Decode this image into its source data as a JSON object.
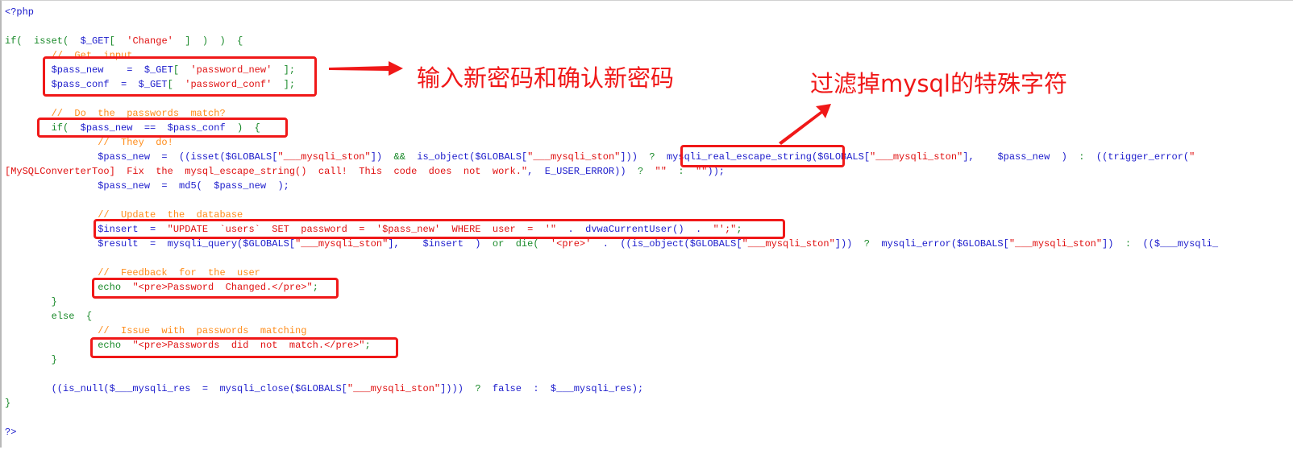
{
  "colors": {
    "variable": "#1c1ccc",
    "keyword": "#1a8a2a",
    "string": "#e01010",
    "comment": "#ff8c1a",
    "annotation": "#f01818"
  },
  "annotations": {
    "input_note": "输入新密码和确认新密码",
    "filter_note": "过滤掉mysql的特殊字符"
  },
  "code": {
    "lines": [
      [
        {
          "c": "b",
          "t": "<?php"
        }
      ],
      [],
      [
        {
          "c": "g",
          "t": "if(  isset(  "
        },
        {
          "c": "b",
          "t": "$_GET"
        },
        {
          "c": "g",
          "t": "[  "
        },
        {
          "c": "r",
          "t": "'Change'"
        },
        {
          "c": "g",
          "t": "  ]  )  )  {"
        }
      ],
      [
        {
          "c": "o",
          "t": "        //  Get  input"
        }
      ],
      [
        {
          "c": "b",
          "t": "        $pass_new    =  $_GET"
        },
        {
          "c": "g",
          "t": "[  "
        },
        {
          "c": "r",
          "t": "'password_new'"
        },
        {
          "c": "g",
          "t": "  ];"
        }
      ],
      [
        {
          "c": "b",
          "t": "        $pass_conf  =  $_GET"
        },
        {
          "c": "g",
          "t": "[  "
        },
        {
          "c": "r",
          "t": "'password_conf'"
        },
        {
          "c": "g",
          "t": "  ];"
        }
      ],
      [],
      [
        {
          "c": "o",
          "t": "        //  Do  the  passwords  match?"
        }
      ],
      [
        {
          "c": "g",
          "t": "        if(  "
        },
        {
          "c": "b",
          "t": "$pass_new  ==  $pass_conf"
        },
        {
          "c": "g",
          "t": "  )  {"
        }
      ],
      [
        {
          "c": "o",
          "t": "                //  They  do!"
        }
      ],
      [
        {
          "c": "b",
          "t": "                $pass_new  =  ((isset($GLOBALS["
        },
        {
          "c": "r",
          "t": "\"___mysqli_ston\""
        },
        {
          "c": "b",
          "t": "])  "
        },
        {
          "c": "g",
          "t": "&&"
        },
        {
          "c": "b",
          "t": "  is_object($GLOBALS["
        },
        {
          "c": "r",
          "t": "\"___mysqli_ston\""
        },
        {
          "c": "b",
          "t": "]))  "
        },
        {
          "c": "g",
          "t": "?"
        },
        {
          "c": "b",
          "t": "  mysqli_real_escape_string($GLOBALS["
        },
        {
          "c": "r",
          "t": "\"___mysqli_ston\""
        },
        {
          "c": "b",
          "t": "],    $pass_new  )  "
        },
        {
          "c": "g",
          "t": ":"
        },
        {
          "c": "b",
          "t": "  ((trigger_error("
        },
        {
          "c": "r",
          "t": "\""
        }
      ],
      [
        {
          "c": "r",
          "t": "[MySQLConverterToo]  Fix  the  mysql_escape_string()  call!  This  code  does  not  work.\""
        },
        {
          "c": "b",
          "t": ",  E_USER_ERROR))  "
        },
        {
          "c": "g",
          "t": "?"
        },
        {
          "c": "r",
          "t": "  \"\""
        },
        {
          "c": "g",
          "t": "  :  "
        },
        {
          "c": "r",
          "t": "\"\""
        },
        {
          "c": "b",
          "t": "));"
        }
      ],
      [
        {
          "c": "b",
          "t": "                $pass_new  =  md5(  $pass_new  );"
        }
      ],
      [],
      [
        {
          "c": "o",
          "t": "                //  Update  the  database"
        }
      ],
      [
        {
          "c": "b",
          "t": "                $insert  =  "
        },
        {
          "c": "r",
          "t": "\"UPDATE  `users`  SET  password  =  '$pass_new'  WHERE  user  =  '\""
        },
        {
          "c": "b",
          "t": "  .  dvwaCurrentUser()  .  "
        },
        {
          "c": "r",
          "t": "\"';\""
        },
        {
          "c": "g",
          "t": ";"
        }
      ],
      [
        {
          "c": "b",
          "t": "                $result  =  mysqli_query($GLOBALS["
        },
        {
          "c": "r",
          "t": "\"___mysqli_ston\""
        },
        {
          "c": "b",
          "t": "],    $insert  )  "
        },
        {
          "c": "g",
          "t": "or  die("
        },
        {
          "c": "r",
          "t": "  '<pre>'"
        },
        {
          "c": "b",
          "t": "  .  ((is_object($GLOBALS["
        },
        {
          "c": "r",
          "t": "\"___mysqli_ston\""
        },
        {
          "c": "b",
          "t": "]))  "
        },
        {
          "c": "g",
          "t": "?"
        },
        {
          "c": "b",
          "t": "  mysqli_error($GLOBALS["
        },
        {
          "c": "r",
          "t": "\"___mysqli_ston\""
        },
        {
          "c": "b",
          "t": "])  "
        },
        {
          "c": "g",
          "t": ":"
        },
        {
          "c": "b",
          "t": "  (($___mysqli_"
        }
      ],
      [],
      [
        {
          "c": "o",
          "t": "                //  Feedback  for  the  user"
        }
      ],
      [
        {
          "c": "g",
          "t": "                echo  "
        },
        {
          "c": "r",
          "t": "\"<pre>Password  Changed.</pre>\""
        },
        {
          "c": "g",
          "t": ";"
        }
      ],
      [
        {
          "c": "g",
          "t": "        }"
        }
      ],
      [
        {
          "c": "g",
          "t": "        else  {"
        }
      ],
      [
        {
          "c": "o",
          "t": "                //  Issue  with  passwords  matching"
        }
      ],
      [
        {
          "c": "g",
          "t": "                echo  "
        },
        {
          "c": "r",
          "t": "\"<pre>Passwords  did  not  match.</pre>\""
        },
        {
          "c": "g",
          "t": ";"
        }
      ],
      [
        {
          "c": "g",
          "t": "        }"
        }
      ],
      [],
      [
        {
          "c": "b",
          "t": "        ((is_null($___mysqli_res  =  mysqli_close($GLOBALS["
        },
        {
          "c": "r",
          "t": "\"___mysqli_ston\""
        },
        {
          "c": "b",
          "t": "])))  "
        },
        {
          "c": "g",
          "t": "?"
        },
        {
          "c": "b",
          "t": "  false  :  $___mysqli_res);"
        }
      ],
      [
        {
          "c": "g",
          "t": "}"
        }
      ],
      [],
      [
        {
          "c": "b",
          "t": "?>"
        }
      ]
    ]
  }
}
